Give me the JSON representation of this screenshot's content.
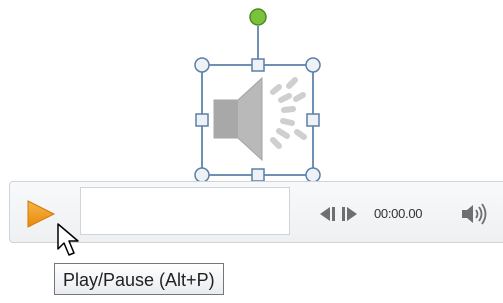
{
  "media_controls": {
    "time": "00:00.00",
    "accent_color": "#f39c12"
  },
  "tooltip": {
    "text": "Play/Pause (Alt+P)"
  },
  "icons": {
    "play": "play-icon",
    "speaker": "speaker-icon",
    "seek_back": "seek-back-icon",
    "seek_forward": "seek-forward-icon",
    "volume": "volume-icon",
    "cursor": "mouse-pointer-icon"
  }
}
